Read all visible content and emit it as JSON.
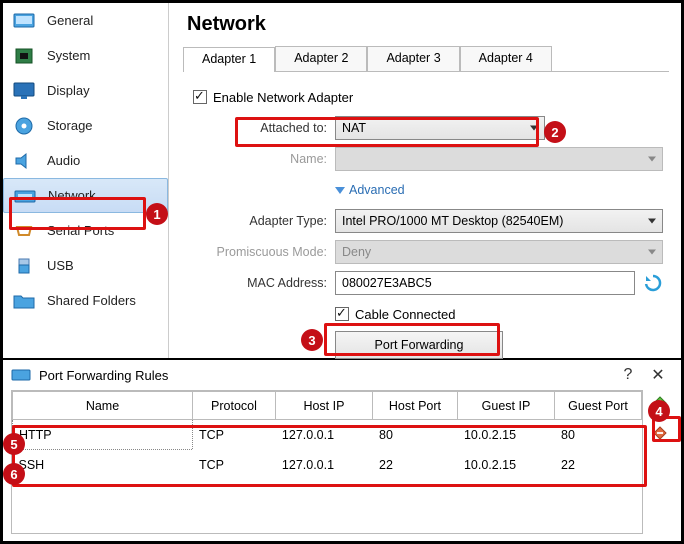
{
  "sidebar": {
    "items": [
      {
        "label": "General"
      },
      {
        "label": "System"
      },
      {
        "label": "Display"
      },
      {
        "label": "Storage"
      },
      {
        "label": "Audio"
      },
      {
        "label": "Network"
      },
      {
        "label": "Serial Ports"
      },
      {
        "label": "USB"
      },
      {
        "label": "Shared Folders"
      }
    ]
  },
  "page": {
    "title": "Network"
  },
  "tabs": [
    "Adapter 1",
    "Adapter 2",
    "Adapter 3",
    "Adapter 4"
  ],
  "form": {
    "enable_label": "Enable Network Adapter",
    "attached_label": "Attached to:",
    "attached_value": "NAT",
    "name_label": "Name:",
    "name_value": "",
    "advanced_label": "Advanced",
    "adapter_type_label": "Adapter Type:",
    "adapter_type_value": "Intel PRO/1000 MT Desktop (82540EM)",
    "promisc_label": "Promiscuous Mode:",
    "promisc_value": "Deny",
    "mac_label": "MAC Address:",
    "mac_value": "080027E3ABC5",
    "cable_label": "Cable Connected",
    "port_fwd_btn": "Port Forwarding"
  },
  "badges": {
    "b1": "1",
    "b2": "2",
    "b3": "3",
    "b4": "4",
    "b5": "5",
    "b6": "6"
  },
  "pf": {
    "title": "Port Forwarding Rules",
    "columns": [
      "Name",
      "Protocol",
      "Host IP",
      "Host Port",
      "Guest IP",
      "Guest Port"
    ],
    "rows": [
      {
        "name": "HTTP",
        "proto": "TCP",
        "hip": "127.0.0.1",
        "hport": "80",
        "gip": "10.0.2.15",
        "gport": "80"
      },
      {
        "name": "SSH",
        "proto": "TCP",
        "hip": "127.0.0.1",
        "hport": "22",
        "gip": "10.0.2.15",
        "gport": "22"
      }
    ]
  }
}
